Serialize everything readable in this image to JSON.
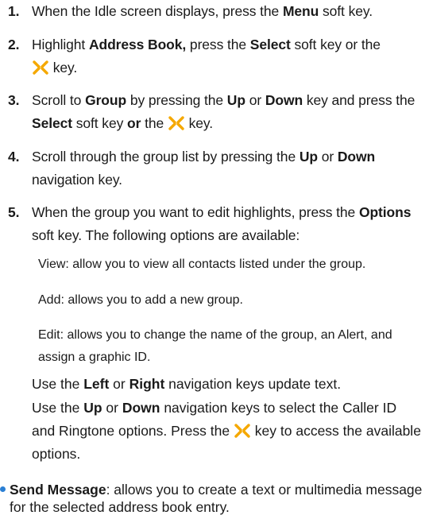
{
  "steps": [
    {
      "num": "1.",
      "t1": "When the Idle screen displays, press the ",
      "b1": "Menu",
      "t2": " soft key."
    },
    {
      "num": "2.",
      "t1": "Highlight ",
      "b1": "Address Book,",
      "t2": " press the ",
      "b2": "Select",
      "t3": " soft key or the",
      "t4": " key."
    },
    {
      "num": "3.",
      "t1": "Scroll to ",
      "b1": "Group",
      "t2": " by pressing the ",
      "b2": "Up",
      "t3": " or ",
      "b3": "Down",
      "t4": " key and press the ",
      "b4": "Select",
      "t5": " soft key ",
      "b5": "or",
      "t6": " the ",
      "t7": " key."
    },
    {
      "num": "4.",
      "t1": "Scroll through the group list by pressing the ",
      "b1": "Up",
      "t2": " or ",
      "b2": "Down",
      "t3": " navigation key."
    },
    {
      "num": "5.",
      "t1": "When the group you want to edit highlights, press the ",
      "b1": "Options",
      "t2": " soft key. The following options are available:"
    }
  ],
  "options": [
    "View: allow you to view all contacts listed under the group.",
    "Add: allows you to add a new group.",
    "Edit: allows you to change the name of the group, an Alert, and assign a graphic ID."
  ],
  "notes": {
    "n1_t1": "Use the ",
    "n1_b1": "Left",
    "n1_t2": " or ",
    "n1_b2": "Right",
    "n1_t3": " navigation keys update text.",
    "n2_t1": "Use the ",
    "n2_b1": "Up",
    "n2_t2": " or ",
    "n2_b2": "Down",
    "n2_t3": " navigation keys to select the Caller ID and Ringtone options. Press the ",
    "n2_t4": " key to access the available options."
  },
  "bullet": {
    "label": "Send Message",
    "text": ": allows you to create a text or multimedia message for the selected address book entry."
  },
  "colors": {
    "navkey": "#f5a800",
    "bullet": "#2a7fd4"
  },
  "icons": {
    "navkey": "navigation-key-icon"
  }
}
